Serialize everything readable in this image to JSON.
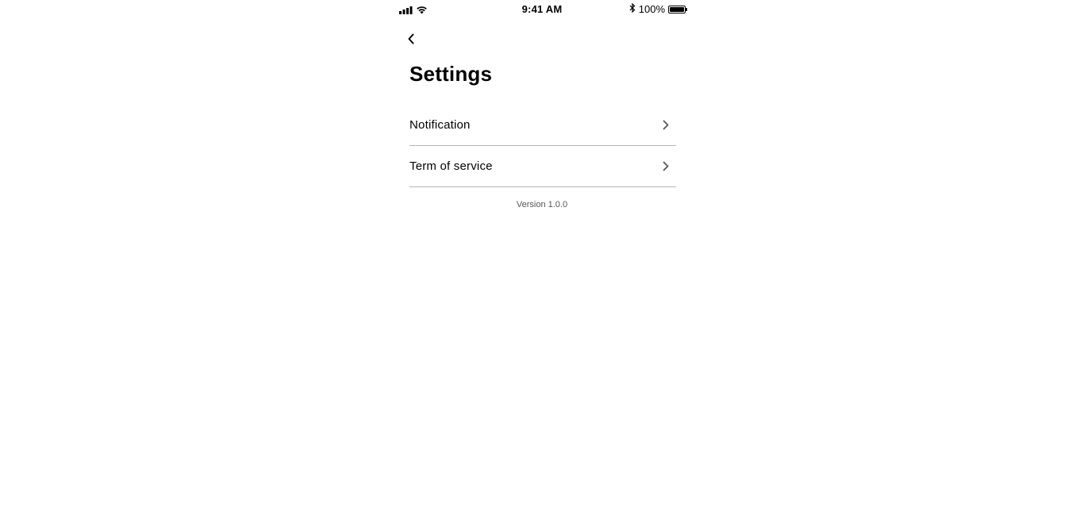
{
  "status_bar": {
    "time": "9:41 AM",
    "battery_text": "100%",
    "battery_level": 1.0,
    "signal_icon": "cellular-signal-icon",
    "wifi_icon": "wifi-icon",
    "bluetooth_icon": "bluetooth-icon"
  },
  "nav": {
    "back_icon": "chevron-left-icon"
  },
  "page": {
    "title": "Settings"
  },
  "settings": {
    "items": [
      {
        "label": "Notification",
        "icon": "chevron-right-icon"
      },
      {
        "label": "Term of service",
        "icon": "chevron-right-icon"
      }
    ]
  },
  "footer": {
    "version": "Version 1.0.0"
  },
  "colors": {
    "background": "#ffffff",
    "text": "#000000",
    "divider": "#b5b5b5",
    "chevron": "#555555",
    "version_text": "#555555"
  }
}
